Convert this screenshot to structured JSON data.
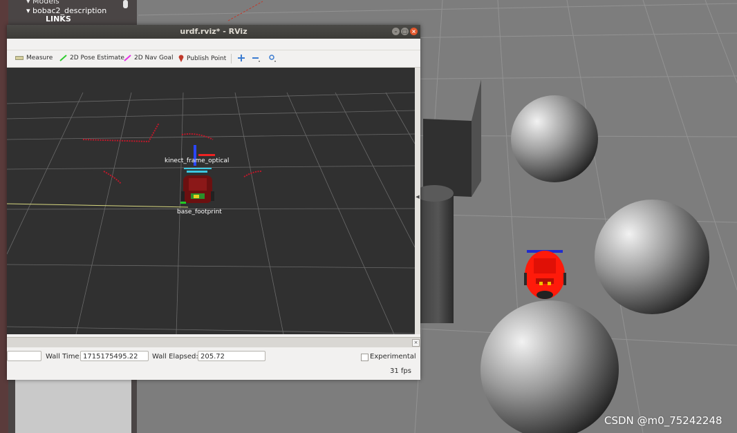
{
  "gazebo_panel": {
    "tree_items": [
      "Models",
      "bobac2_description",
      "LINKS"
    ]
  },
  "rviz": {
    "window_title": "urdf.rviz* - RViz",
    "window_buttons": {
      "minimize": "–",
      "maximize": "□",
      "close": "×"
    },
    "toolbar": {
      "measure": "Measure",
      "pose_estimate": "2D Pose Estimate",
      "nav_goal": "2D Nav Goal",
      "publish_point": "Publish Point"
    },
    "viewport": {
      "frame_labels": [
        "kinect_frame_optical",
        "base_footprint"
      ]
    },
    "time_panel": {
      "wall_time_label": "Wall Time:",
      "wall_time_value": "1715175495.22",
      "wall_elapsed_label": "Wall Elapsed:",
      "wall_elapsed_value": "205.72",
      "experimental_label": "Experimental",
      "fps": "31 fps",
      "first_field_value": ""
    },
    "dock_close": "×"
  },
  "watermark": "CSDN @m0_75242248",
  "colors": {
    "viewport_bg": "#303030",
    "gazebo_ground": "#7b7b7b",
    "close_button": "#e2572c",
    "robot_red": "#ff1a0a"
  },
  "icons": [
    "measure-icon",
    "pose-estimate-icon",
    "nav-goal-icon",
    "publish-point-icon",
    "move-camera-icon",
    "zoom-icon",
    "view-icon",
    "window-close-icon"
  ]
}
